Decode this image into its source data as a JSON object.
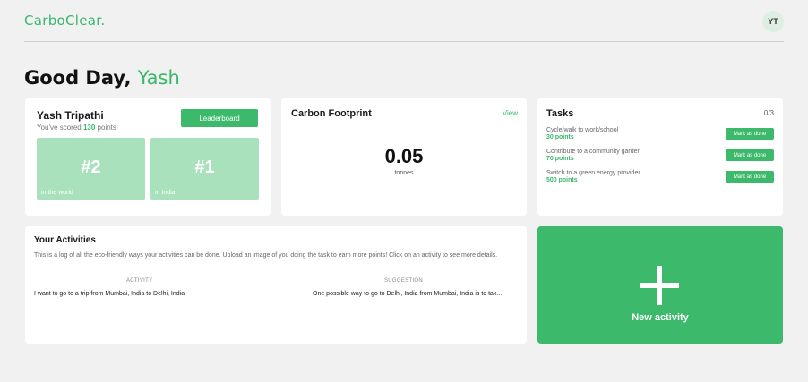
{
  "header": {
    "logo": "CarboClear.",
    "avatar_initials": "YT"
  },
  "greeting": {
    "prefix": "Good Day,",
    "name": "Yash"
  },
  "profile": {
    "name": "Yash Tripathi",
    "score_prefix": "You've scored",
    "score_points": "130",
    "score_suffix": "points",
    "leaderboard_label": "Leaderboard",
    "ranks": [
      {
        "value": "#2",
        "label": "in the world"
      },
      {
        "value": "#1",
        "label": "in India"
      }
    ]
  },
  "footprint": {
    "title": "Carbon Footprint",
    "view_label": "View",
    "value": "0.05",
    "unit": "tonnes"
  },
  "tasks": {
    "title": "Tasks",
    "count": "0/3",
    "items": [
      {
        "name": "Cycle/walk to work/school",
        "points": "30 points",
        "button": "Mark as done"
      },
      {
        "name": "Contribute to a community garden",
        "points": "70 points",
        "button": "Mark as done"
      },
      {
        "name": "Switch to a green energy provider",
        "points": "500 points",
        "button": "Mark as done"
      }
    ]
  },
  "activities": {
    "title": "Your Activities",
    "description": "This is a log of all the eco-friendly ways your activities can be done. Upload an image of you doing the task to earn more points! Click on an activity to see more details.",
    "columns": [
      "ACTIVITY",
      "SUGGESTION"
    ],
    "rows": [
      {
        "activity": "I want to go to a trip from Mumbai, India to Delhi, India",
        "suggestion": "One possible way to go to Delhi, India from Mumbai, India is to tak..."
      }
    ]
  },
  "new_activity": {
    "label": "New activity"
  },
  "colors": {
    "accent": "#3cb96a",
    "rank_box": "#a8e1bc",
    "background": "#f1f1f1"
  }
}
